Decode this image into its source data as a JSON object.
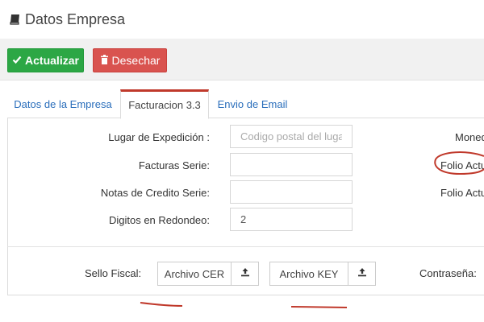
{
  "header": {
    "title": "Datos Empresa",
    "icon": "book-icon"
  },
  "toolbar": {
    "update_label": "Actualizar",
    "discard_label": "Desechar",
    "update_color": "#2ca745",
    "discard_color": "#d9534f"
  },
  "tabs": [
    {
      "label": "Datos de la Empresa",
      "active": false
    },
    {
      "label": "Facturacion 3.3",
      "active": true
    },
    {
      "label": "Envio de Email",
      "active": false
    }
  ],
  "form": {
    "fields": [
      {
        "label": "Lugar de Expedición :",
        "value": "",
        "placeholder": "Codigo postal del lugar"
      },
      {
        "label": "Facturas Serie:",
        "value": "",
        "placeholder": ""
      },
      {
        "label": "Notas de Credito Serie:",
        "value": "",
        "placeholder": ""
      },
      {
        "label": "Digitos en Redondeo:",
        "value": "2",
        "placeholder": ""
      }
    ],
    "right_labels": [
      "Moned",
      "Folio Actu",
      "Folio Actu"
    ]
  },
  "sello": {
    "label": "Sello Fiscal:",
    "cer_label": "Archivo CER",
    "key_label": "Archivo KEY",
    "password_label": "Contraseña:"
  },
  "accent_color": "#c0392b"
}
